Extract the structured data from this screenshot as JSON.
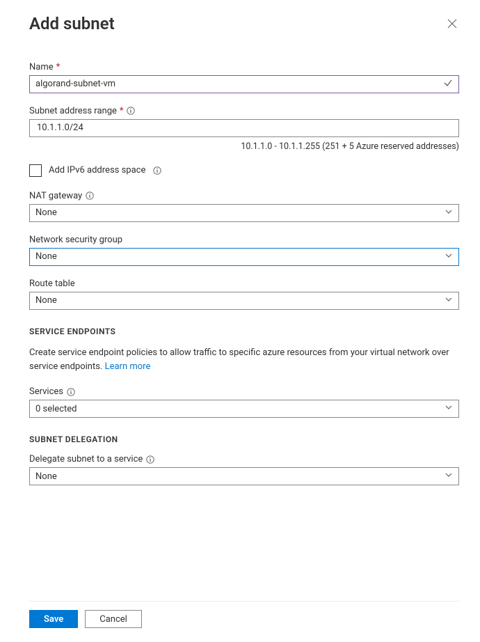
{
  "header": {
    "title": "Add subnet"
  },
  "fields": {
    "name_label": "Name",
    "name_value": "algorand-subnet-vm",
    "range_label": "Subnet address range",
    "range_value": "10.1.1.0/24",
    "range_helper": "10.1.1.0 - 10.1.1.255 (251 + 5 Azure reserved addresses)",
    "ipv6_label": "Add IPv6 address space",
    "nat_label": "NAT gateway",
    "nat_value": "None",
    "nsg_label": "Network security group",
    "nsg_value": "None",
    "route_label": "Route table",
    "route_value": "None"
  },
  "service_endpoints": {
    "heading": "SERVICE ENDPOINTS",
    "description": "Create service endpoint policies to allow traffic to specific azure resources from your virtual network over service endpoints. ",
    "learn_more": "Learn more",
    "services_label": "Services",
    "services_value": "0 selected"
  },
  "delegation": {
    "heading": "SUBNET DELEGATION",
    "label": "Delegate subnet to a service",
    "value": "None"
  },
  "footer": {
    "save": "Save",
    "cancel": "Cancel"
  }
}
